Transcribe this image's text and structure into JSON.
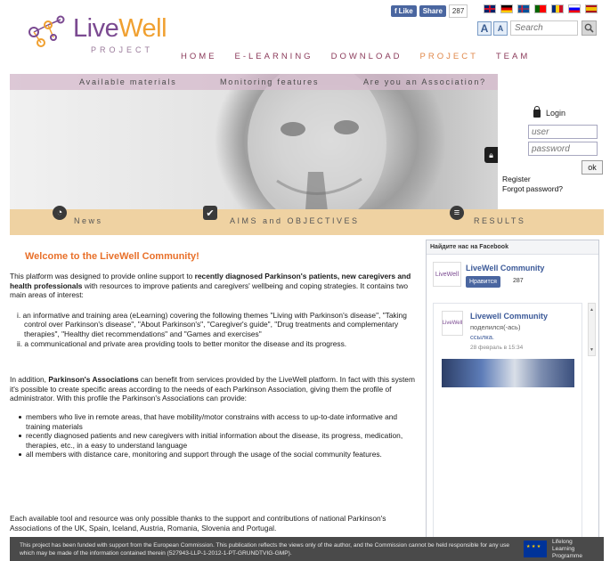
{
  "brand": {
    "live": "Live",
    "well": "Well",
    "project": "PROJECT"
  },
  "social": {
    "like_label": "Like",
    "share_label": "Share",
    "count": "287"
  },
  "languages": [
    "English",
    "Deutsch",
    "Íslenska",
    "Português",
    "Română",
    "Slovenščina",
    "Español"
  ],
  "font_controls": {
    "larger": "A",
    "smaller": "A"
  },
  "search": {
    "placeholder": "Search"
  },
  "nav": {
    "items": [
      "HOME",
      "E-LEARNING",
      "DOWNLOAD",
      "PROJECT",
      "TEAM"
    ],
    "active": "PROJECT"
  },
  "banner": {
    "top_items": [
      "Available materials",
      "Monitoring features",
      "Are you an Association?"
    ],
    "bottom_items": [
      "News",
      "AIMS and OBJECTIVES",
      "RESULTS"
    ]
  },
  "login": {
    "title": "Login",
    "user_placeholder": "user",
    "password_placeholder": "password",
    "ok_label": "ok",
    "register_label": "Register",
    "forgot_label": "Forgot password?"
  },
  "main": {
    "welcome": "Welcome to the LiveWell Community!",
    "intro_1": "This platform was designed to provide online support to ",
    "intro_bold": "recently diagnosed Parkinson's patients, new caregivers and health professionals",
    "intro_2": " with resources to improve patients and caregivers' wellbeing and coping strategies. It contains two main areas of interest:",
    "areas": [
      "i. an informative and training area (eLearning) covering the following themes \"Living with Parkinson's disease\", \"Taking control over Parkinson's disease\", \"About Parkinson's\", \"Caregiver's guide\", \"Drug treatments and complementary therapies\", \"Healthy diet recommendations\" and \"Games and exercises\"",
      "ii. a communicational and private area providing tools to better monitor the disease and its progress."
    ],
    "assoc_1": "In addition, ",
    "assoc_bold": "Parkinson's Associations",
    "assoc_2": " can benefit from services provided by the LiveWell platform. In fact with this system it's possible to create specific areas according to the needs of each Parkinson Association, giving them the profile of administrator. With this profile the Parkinson's Associations can provide:",
    "services": [
      "members who live in remote areas, that have mobility/motor constrains with access to up-to-date informative and training materials",
      "recently diagnosed patients and new caregivers with initial information about the disease, its progress, medication, therapies, etc., in a easy to understand language",
      "all members with distance care, monitoring and support through the usage of the social community features."
    ],
    "closing": "Each available tool and resource was only possible thanks to the support and contributions of national Parkinson's Associations of the UK, Spain, Iceland, Austria, Romania, Slovenia and Portugal."
  },
  "facebook_widget": {
    "header": "Найдите нас на Facebook",
    "page_name": "LiveWell Community",
    "like_label": "Нравится",
    "like_count": "287",
    "post_author": "Livewell Community",
    "post_action": "поделился(-ась)",
    "post_link": "ссылка.",
    "post_date": "28 февраль в 15:34",
    "logo_text": "LiveWell"
  },
  "footer": {
    "text": "This project has been funded with support from the European Commission. This publication reflects the views only of the author, and the Commission cannot be held responsible for any use which may be made of the information contained therein (527943-LLP-1-2012-1-PT-GRUNDTVIG-GMP).",
    "program_line1": "Lifelong",
    "program_line2": "Learning",
    "program_line3": "Programme"
  }
}
